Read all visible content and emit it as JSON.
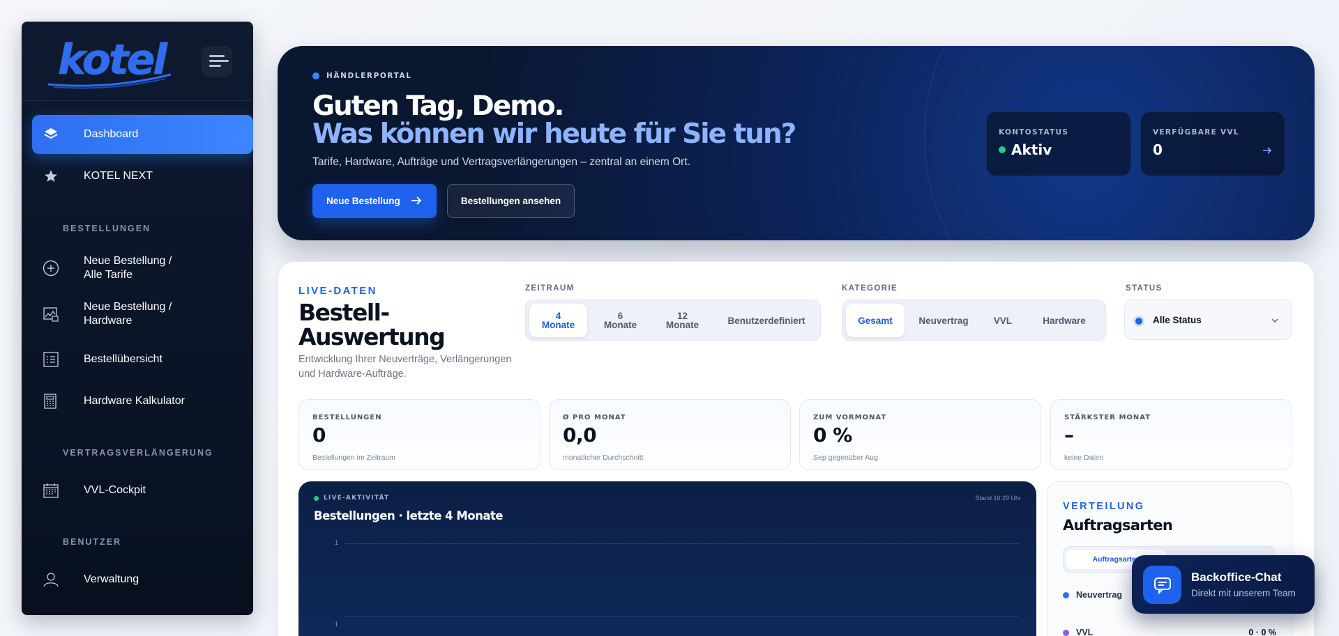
{
  "sidebar": {
    "logo_text": "kotel",
    "items": [
      {
        "label": "Dashboard"
      },
      {
        "label": "KOTEL NEXT"
      },
      {
        "label": "Neue Bestellung /\nAlle Tarife"
      },
      {
        "label": "Neue Bestellung /\nHardware"
      },
      {
        "label": "Bestellübersicht"
      },
      {
        "label": "Hardware Kalkulator"
      },
      {
        "label": "VVL-Cockpit"
      },
      {
        "label": "Verwaltung"
      }
    ],
    "sections": {
      "orders": "BESTELLUNGEN",
      "renewal": "VERTRAGSVERLÄNGERUNG",
      "users": "BENUTZER"
    }
  },
  "hero": {
    "badge": "HÄNDLERPORTAL",
    "greeting": "Guten Tag, Demo.",
    "question": "Was können wir heute für Sie tun?",
    "subtitle": "Tarife, Hardware, Aufträge und Vertragsverlängerungen – zentral an einem Ort.",
    "primary_button": "Neue Bestellung",
    "secondary_button": "Bestellungen ansehen",
    "cards": {
      "status_label": "KONTOSTATUS",
      "status_value": "Aktiv",
      "vvl_label": "VERFÜGBARE VVL",
      "vvl_value": "0"
    }
  },
  "analytics": {
    "eyebrow": "LIVE-DATEN",
    "title": "Bestell-\nAuswertung",
    "description": "Entwicklung Ihrer Neuverträge, Verlängerungen und Hardware-Aufträge.",
    "filters": {
      "period_label": "ZEITRAUM",
      "period_options": [
        "4\nMonate",
        "6\nMonate",
        "12\nMonate",
        "Benutzerdefiniert"
      ],
      "category_label": "KATEGORIE",
      "category_options": [
        "Gesamt",
        "Neuvertrag",
        "VVL",
        "Hardware"
      ],
      "status_label": "STATUS",
      "status_value": "Alle Status"
    },
    "kpis": [
      {
        "label": "BESTELLUNGEN",
        "value": "0",
        "sub": "Bestellungen im Zeitraum"
      },
      {
        "label": "Ø PRO MONAT",
        "value": "0,0",
        "sub": "monatlicher Durchschnitt"
      },
      {
        "label": "ZUM VORMONAT",
        "value": "0 %",
        "sub": "Sep gegenüber Aug"
      },
      {
        "label": "STÄRKSTER MONAT",
        "value": "–",
        "sub": "keine Daten"
      }
    ],
    "chart": {
      "badge": "LIVE-AKTIVITÄT",
      "stamp": "Stand 16:29 Uhr",
      "title": "Bestellungen · letzte 4 Monate",
      "y_ticks": [
        "1",
        "1"
      ]
    },
    "distribution": {
      "eyebrow": "VERTEILUNG",
      "title": "Auftragsarten",
      "tab": "Auftragsarten",
      "rows": [
        {
          "label": "Neuvertrag",
          "value": "",
          "color": "#2f6cf2"
        },
        {
          "label": "VVL",
          "value": "0 · 0 %",
          "color": "#8b5cf6"
        }
      ]
    }
  },
  "chat": {
    "title": "Backoffice-Chat",
    "subtitle": "Direkt mit unserem Team"
  },
  "colors": {
    "accent": "#2d6ff0",
    "sidebar_bg": "#0d1a30",
    "hero_bg": "#0c2359",
    "success": "#22c98a"
  }
}
